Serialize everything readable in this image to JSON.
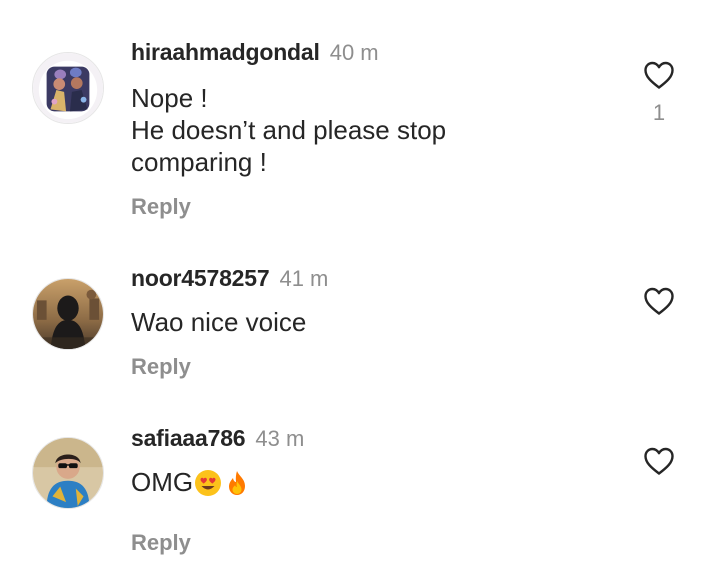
{
  "comments": [
    {
      "username": "hiraahmadgondal",
      "time": "40 m",
      "text_lines": [
        "Nope !",
        "He doesn’t and please stop",
        "comparing !"
      ],
      "reply_label": "Reply",
      "like_count": "1",
      "like_icon": "heart-outline-icon",
      "avatar_icon": "avatar-icon"
    },
    {
      "username": "noor4578257",
      "time": "41 m",
      "text_lines": [
        "Wao nice voice"
      ],
      "reply_label": "Reply",
      "like_icon": "heart-outline-icon",
      "avatar_icon": "avatar-icon"
    },
    {
      "username": "safiaaa786",
      "time": "43 m",
      "text_lines": [
        "OMG"
      ],
      "emojis": [
        "heart-eyes-emoji",
        "fire-emoji"
      ],
      "reply_label": "Reply",
      "like_icon": "heart-outline-icon",
      "avatar_icon": "avatar-icon"
    }
  ],
  "colors": {
    "text": "#262626",
    "secondary": "#8e8e8e",
    "background": "#ffffff"
  }
}
